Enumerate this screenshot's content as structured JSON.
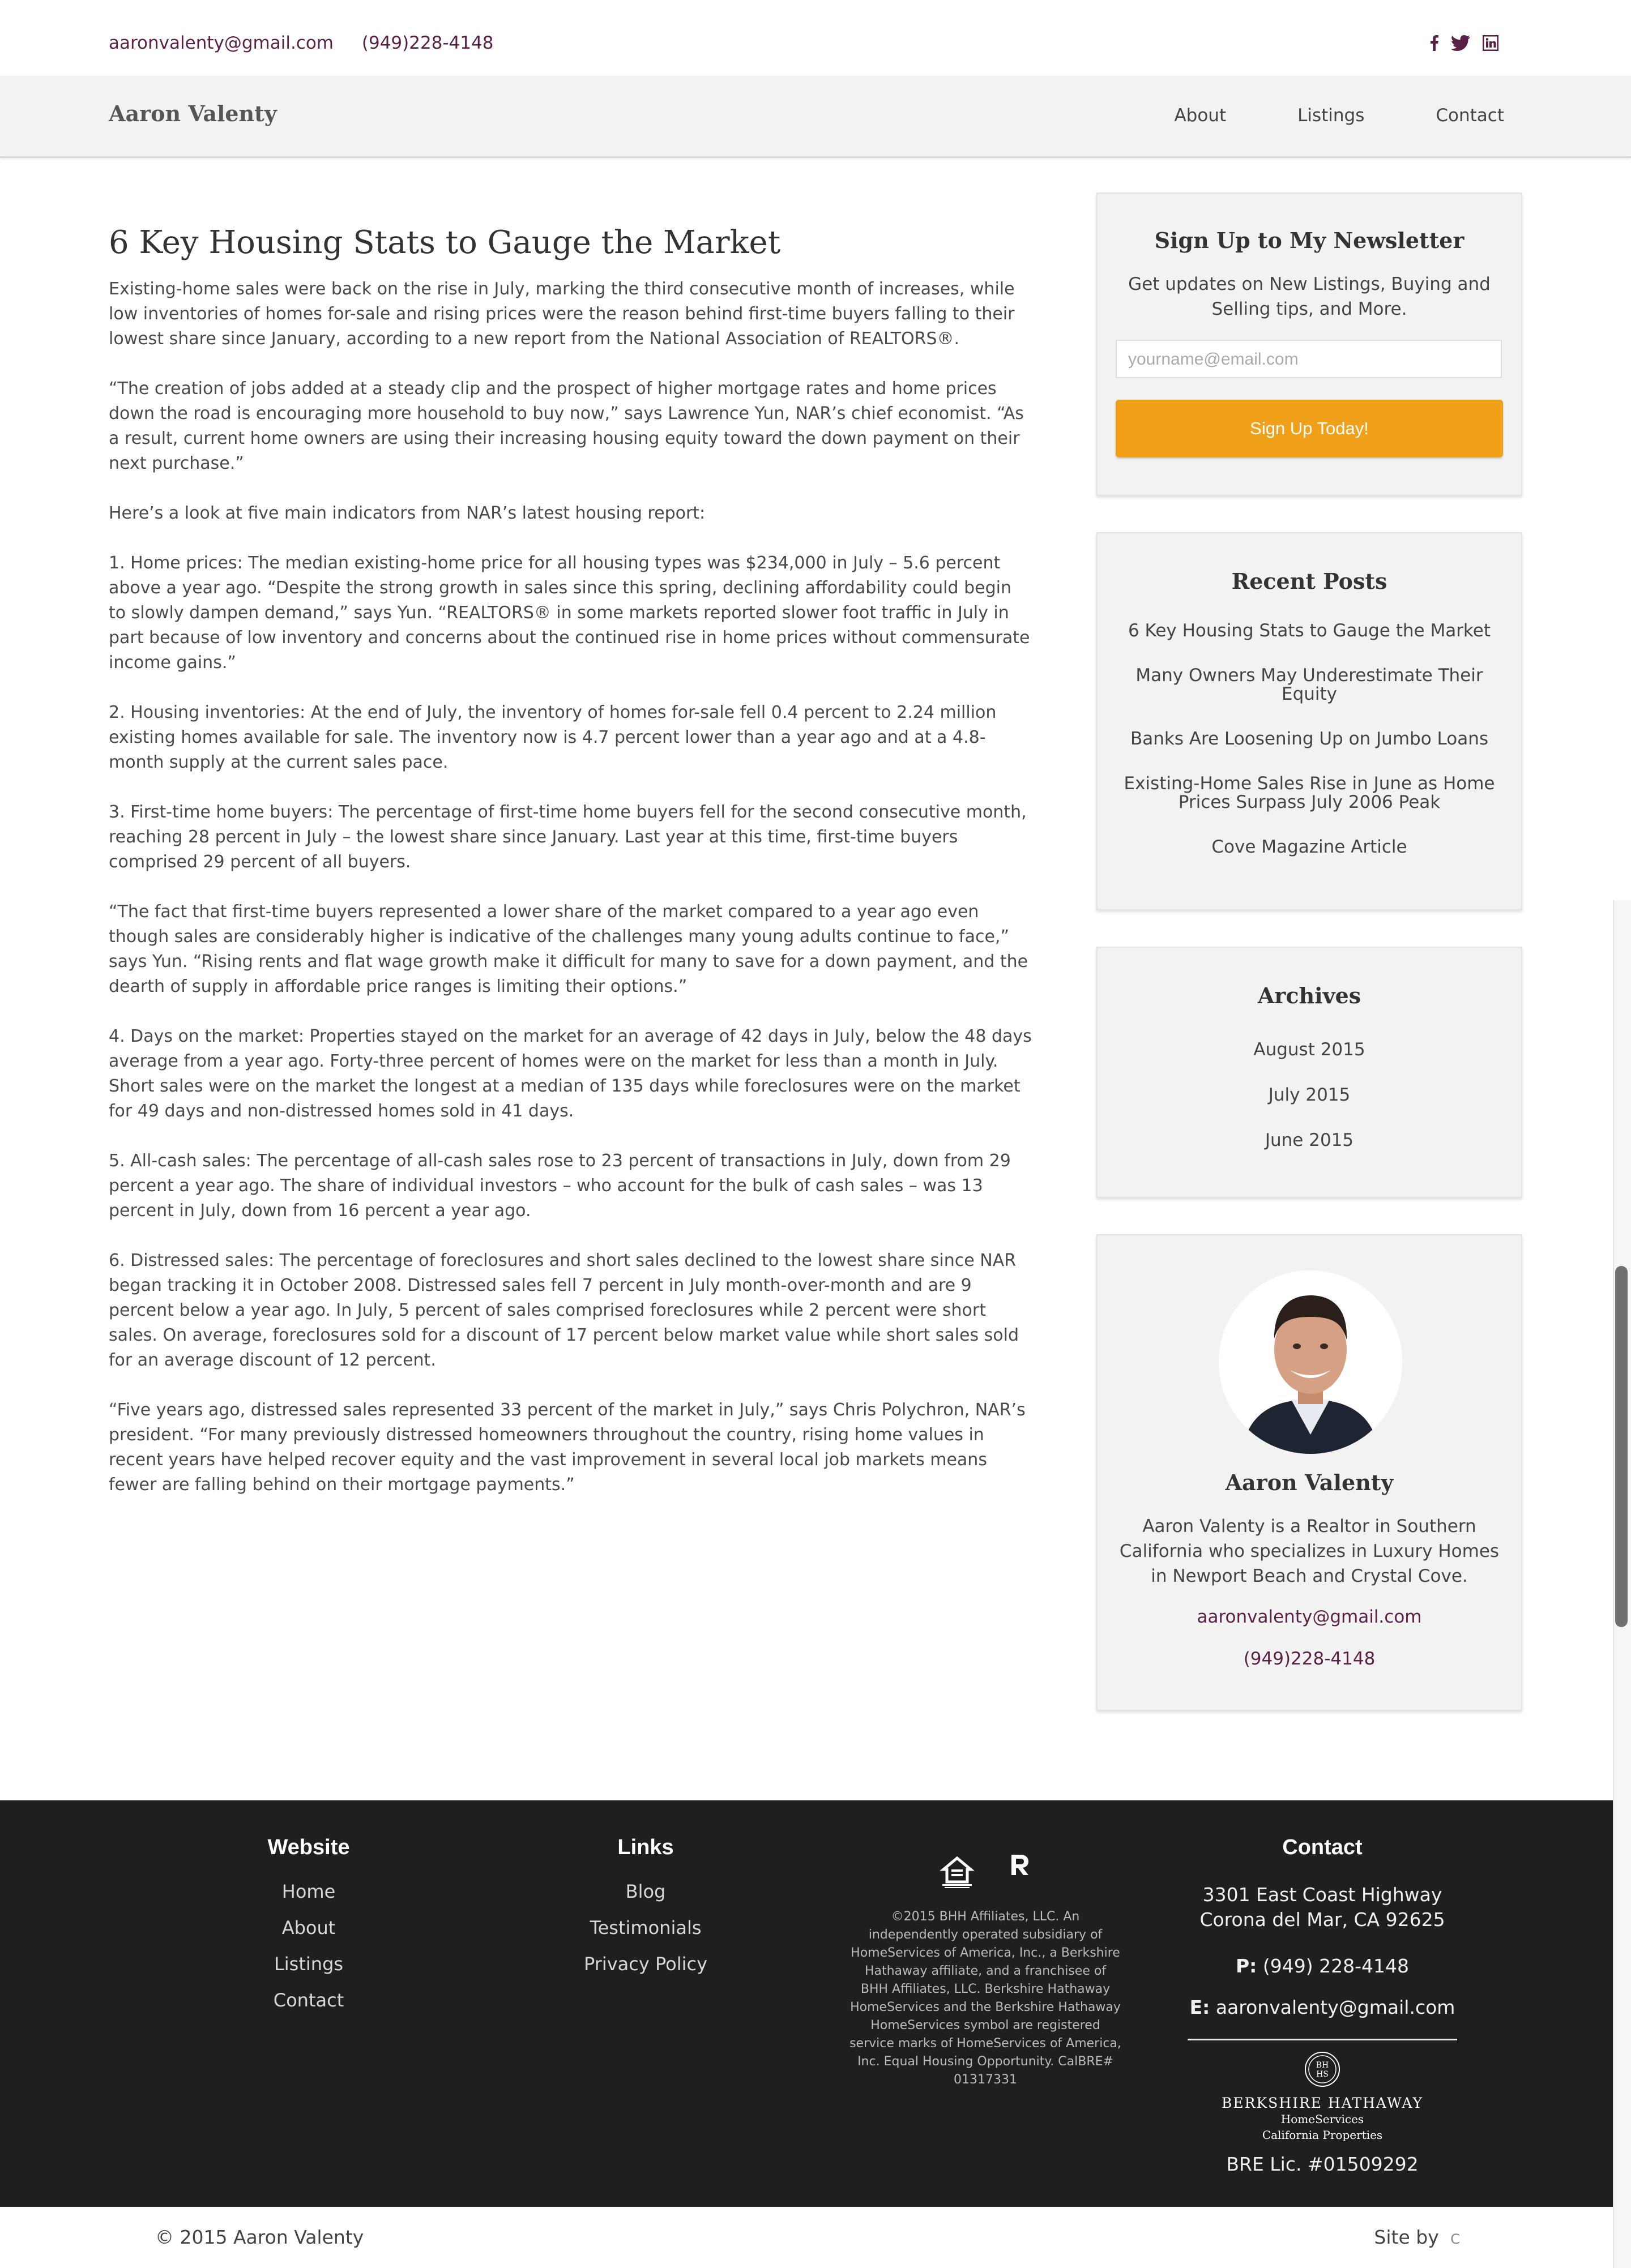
{
  "topbar": {
    "email": "aaronvalenty@gmail.com",
    "phone": "(949)228-4148",
    "social": [
      {
        "icon": "facebook-icon",
        "glyph": "f"
      },
      {
        "icon": "twitter-icon",
        "glyph": "t"
      },
      {
        "icon": "linkedin-icon",
        "glyph": "in"
      }
    ]
  },
  "nav": {
    "brand": "Aaron Valenty",
    "items": [
      "About",
      "Listings",
      "Contact"
    ]
  },
  "article": {
    "title": "6 Key Housing Stats to Gauge the Market",
    "paragraphs": [
      "Existing-home sales were back on the rise in July, marking the third consecutive month of increases, while low inventories of homes for-sale and rising prices were the reason behind first-time buyers falling to their lowest share since January, according to a new report from the National Association of REALTORS®.",
      "“The creation of jobs added at a steady clip and the prospect of higher mortgage rates and home prices down the road is encouraging more household to buy now,” says Lawrence Yun, NAR’s chief economist. “As a result, current home owners are using their increasing housing equity toward the down payment on their next purchase.”",
      "Here’s a look at five main indicators from NAR’s latest housing report:",
      "1. Home prices: The median existing-home price for all housing types was $234,000 in July – 5.6 percent above a year ago. “Despite the strong growth in sales since this spring, declining affordability could begin to slowly dampen demand,” says Yun. “REALTORS® in some markets reported slower foot traffic in July in part because of low inventory and concerns about the continued rise in home prices without commensurate income gains.”",
      "2. Housing inventories: At the end of July, the inventory of homes for-sale fell 0.4 percent to 2.24 million existing homes available for sale. The inventory now is 4.7 percent lower than a year ago and at a 4.8-month supply at the current sales pace.",
      "3. First-time home buyers: The percentage of first-time home buyers fell for the second consecutive month, reaching 28 percent in July – the lowest share since January. Last year at this time, first-time buyers comprised 29 percent of all buyers.",
      "“The fact that first-time buyers represented a lower share of the market compared to a year ago even though sales are considerably higher is indicative of the challenges many young adults continue to face,” says Yun. “Rising rents and flat wage growth make it difficult for many to save for a down payment, and the dearth of supply in affordable price ranges is limiting their options.”",
      "4. Days on the market: Properties stayed on the market for an average of 42 days in July, below the 48 days average from a year ago. Forty-three percent of homes were on the market for less than a month in July. Short sales were on the market the longest at a median of 135 days while foreclosures were on the market for 49 days and non-distressed homes sold in 41 days.",
      "5. All-cash sales: The percentage of all-cash sales rose to 23 percent of transactions in July, down from 29 percent a year ago. The share of individual investors – who account for the bulk of cash sales – was 13 percent in July, down from 16 percent a year ago.",
      "6. Distressed sales: The percentage of foreclosures and short sales declined to the lowest share since NAR began tracking it in October 2008. Distressed sales fell 7 percent in July month-over-month and are 9 percent below a year ago. In July, 5 percent of sales comprised foreclosures while 2 percent were short sales. On average, foreclosures sold for a discount of 17 percent below market value while short sales sold for an average discount of 12 percent.",
      "“Five years ago, distressed sales represented 33 percent of the market in July,” says Chris Polychron, NAR’s president. “For many previously distressed homeowners throughout the country, rising home values in recent years have helped recover equity and the vast improvement in several local job markets means fewer are falling behind on their mortgage payments.”"
    ]
  },
  "newsletter": {
    "title": "Sign Up to My Newsletter",
    "subtitle": "Get updates on New Listings, Buying and Selling tips, and More.",
    "placeholder": "yourname@email.com",
    "button": "Sign Up Today!",
    "button_color": "#f0a019"
  },
  "recent_posts": {
    "title": "Recent Posts",
    "items": [
      "6 Key Housing Stats to Gauge the Market",
      "Many Owners May Underestimate Their Equity",
      "Banks Are Loosening Up on Jumbo Loans",
      "Existing-Home Sales Rise in June as Home Prices Surpass July 2006 Peak",
      "Cove Magazine Article"
    ]
  },
  "archives": {
    "title": "Archives",
    "items": [
      "August 2015",
      "July 2015",
      "June 2015"
    ]
  },
  "bio": {
    "name": "Aaron Valenty",
    "text": "Aaron Valenty is a Realtor in Southern California who specializes in Luxury Homes in Newport Beach and Crystal Cove.",
    "email": "aaronvalenty@gmail.com",
    "phone": "(949)228-4148",
    "accent": "#5a1f45"
  },
  "footer": {
    "website": {
      "title": "Website",
      "items": [
        "Home",
        "About",
        "Listings",
        "Contact"
      ]
    },
    "links": {
      "title": "Links",
      "items": [
        "Blog",
        "Testimonials",
        "Privacy Policy"
      ]
    },
    "legal": "©2015 BHH Affiliates, LLC. An independently operated subsidiary of HomeServices of America, Inc., a Berkshire Hathaway affiliate, and a franchisee of BHH Affiliates, LLC. Berkshire Hathaway HomeServices and the Berkshire Hathaway HomeServices symbol are registered service marks of HomeServices of America, Inc. Equal Housing Opportunity. CalBRE# 01317331",
    "contact": {
      "title": "Contact",
      "address_line1": "3301 East Coast Highway",
      "address_line2": "Corona del Mar, CA 92625",
      "phone_label": "P:",
      "phone": "(949) 228-4148",
      "email_label": "E:",
      "email": "aaronvalenty@gmail.com",
      "brand_name": "BERKSHIRE HATHAWAY",
      "brand_sub1": "HomeServices",
      "brand_sub2": "California Properties",
      "license": "BRE Lic. #01509292"
    }
  },
  "bottom": {
    "copyright": "© 2015 Aaron Valenty",
    "site_by": "Site by"
  }
}
